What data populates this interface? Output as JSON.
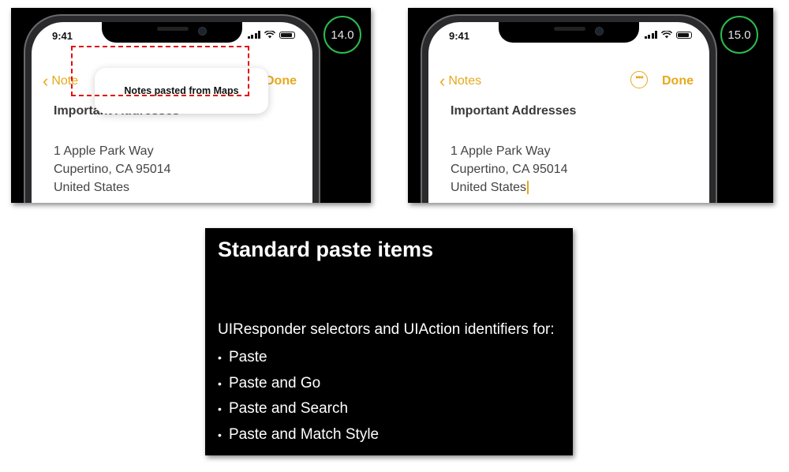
{
  "left_phone": {
    "version_badge": "14.0",
    "time": "9:41",
    "back_label": "Note",
    "done_label": "Done",
    "banner_text": "Notes pasted from Maps",
    "note_title": "Important Addresses",
    "address_lines": [
      "1 Apple Park Way",
      "Cupertino, CA  95014",
      "United States"
    ]
  },
  "right_phone": {
    "version_badge": "15.0",
    "time": "9:41",
    "back_label": "Notes",
    "done_label": "Done",
    "more_icon": "ellipsis-circle-icon",
    "note_title": "Important Addresses",
    "address_lines": [
      "1 Apple Park Way",
      "Cupertino, CA  95014",
      "United States"
    ]
  },
  "slide": {
    "title": "Standard paste items",
    "intro": "UIResponder selectors and UIAction identifiers for:",
    "items": [
      "Paste",
      "Paste and Go",
      "Paste and Search",
      "Paste and Match Style"
    ]
  },
  "colors": {
    "accent_yellow": "#e6a91c",
    "badge_green": "#2dbb4c",
    "highlight_red": "#e01010"
  }
}
